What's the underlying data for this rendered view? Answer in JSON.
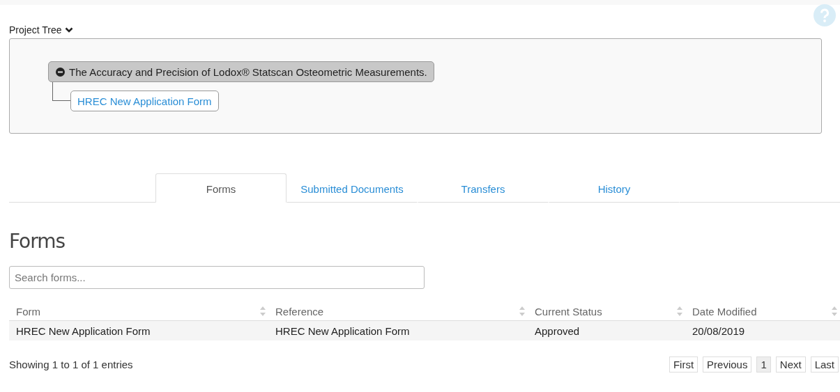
{
  "project_tree": {
    "label": "Project Tree",
    "expanded": true,
    "nodes": [
      {
        "label": "The Accuracy and Precision of Lodox® Statscan Osteometric Measurements.",
        "expanded": true,
        "children": [
          {
            "label": "HREC New Application Form"
          }
        ]
      }
    ]
  },
  "tabs": [
    {
      "label": "Forms",
      "selected": true
    },
    {
      "label": "Submitted Documents",
      "selected": false
    },
    {
      "label": "Transfers",
      "selected": false
    },
    {
      "label": "History",
      "selected": false
    }
  ],
  "section_title": "Forms",
  "search": {
    "placeholder": "Search forms..."
  },
  "table": {
    "columns": [
      "Form",
      "Reference",
      "Current Status",
      "Date Modified"
    ],
    "rows": [
      [
        "HREC New Application Form",
        "HREC New Application Form",
        "Approved",
        "20/08/2019"
      ]
    ]
  },
  "info": "Showing 1 to 1 of 1 entries",
  "pagination": [
    {
      "label": "First",
      "selected": false
    },
    {
      "label": "Previous",
      "selected": false
    },
    {
      "label": "1",
      "selected": true
    },
    {
      "label": "Next",
      "selected": false
    },
    {
      "label": "Last",
      "selected": false
    }
  ]
}
